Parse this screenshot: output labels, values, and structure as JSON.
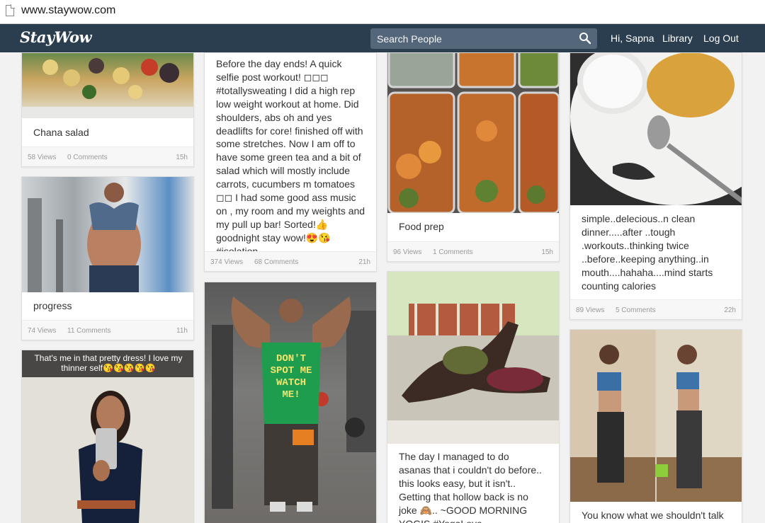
{
  "browser": {
    "url": "www.staywow.com"
  },
  "nav": {
    "logo": "StayWow",
    "search_placeholder": "Search People",
    "greeting": "Hi, Sapna",
    "library": "Library",
    "logout": "Log Out"
  },
  "posts": [
    {
      "text": "Chana salad",
      "views": "58 Views",
      "comments": "0 Comments",
      "time": "15h"
    },
    {
      "text": "progress",
      "views": "74 Views",
      "comments": "11 Comments",
      "time": "11h"
    },
    {
      "caption": "That's me in that pretty dress! I love my thinner self😘😘😘😘😘"
    },
    {
      "text": "Before the day ends! A quick selfie post workout! ◻◻◻ #totallysweating I did a high rep low weight workout at home. Did shoulders, abs oh and yes deadlifts for core! finished off with some stretches. Now I am off to have some green tea and a bit of salad which will mostly include carrots, cucumbers m tomatoes ◻◻  I had some good ass music on , my room and my weights and my pull up bar! Sorted!👍 goodnight stay wow!😍😘 #isolation",
      "views": "374 Views",
      "comments": "68 Comments",
      "time": "21h"
    },
    {
      "tshirt": "DON'T SPOT ME WATCH ME!"
    },
    {
      "text": "Food prep",
      "views": "96 Views",
      "comments": "1 Comments",
      "time": "15h"
    },
    {
      "text": "The day I managed to do asanas that i couldn't do before.. this looks easy, but it isn't.. Getting that hollow back is no joke 🙈.. ~GOOD MORNING YOGIS #YogaLove #YogaForLife"
    },
    {
      "text": "simple..delecious..n clean dinner.....after ..tough .workouts..thinking twice ..before..keeping anything..in mouth....hahaha....mind starts counting calories",
      "views": "89 Views",
      "comments": "5 Comments",
      "time": "22h"
    },
    {
      "text": "You know what we shouldn't talk"
    }
  ]
}
